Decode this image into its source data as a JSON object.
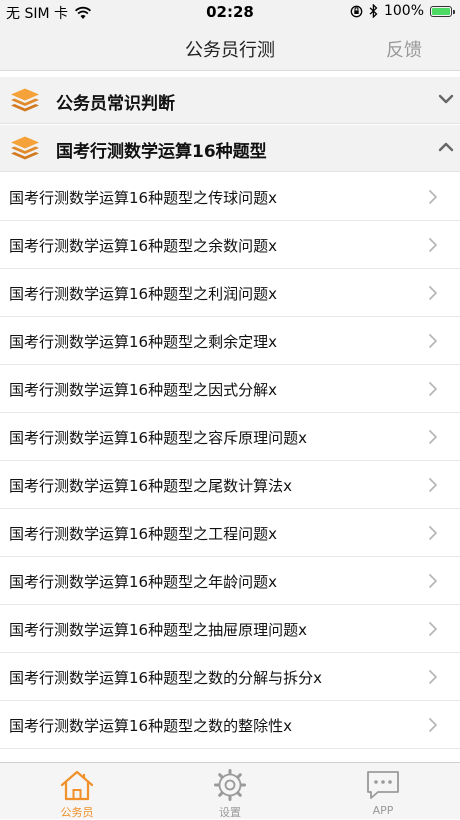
{
  "status_bar": {
    "carrier": "无 SIM 卡",
    "time": "02:28",
    "battery": "100%",
    "battery_level": 1.0
  },
  "header": {
    "title": "公务员行测",
    "feedback_label": "反馈"
  },
  "sections": [
    {
      "label": "公务员常识判断",
      "expanded": false
    },
    {
      "label": "国考行测数学运算16种题型",
      "expanded": true
    }
  ],
  "items": [
    {
      "label": "国考行测数学运算16种题型之传球问题x"
    },
    {
      "label": "国考行测数学运算16种题型之余数问题x"
    },
    {
      "label": "国考行测数学运算16种题型之利润问题x"
    },
    {
      "label": "国考行测数学运算16种题型之剩余定理x"
    },
    {
      "label": "国考行测数学运算16种题型之因式分解x"
    },
    {
      "label": "国考行测数学运算16种题型之容斥原理问题x"
    },
    {
      "label": "国考行测数学运算16种题型之尾数计算法x"
    },
    {
      "label": "国考行测数学运算16种题型之工程问题x"
    },
    {
      "label": "国考行测数学运算16种题型之年龄问题x"
    },
    {
      "label": "国考行测数学运算16种题型之抽屉原理问题x"
    },
    {
      "label": "国考行测数学运算16种题型之数的分解与拆分x"
    },
    {
      "label": "国考行测数学运算16种题型之数的整除性x"
    }
  ],
  "tabs": [
    {
      "label": "公务员",
      "icon": "home-icon",
      "active": true
    },
    {
      "label": "设置",
      "icon": "gear-icon",
      "active": false
    },
    {
      "label": "APP",
      "icon": "chat-bubble-icon",
      "active": false
    }
  ],
  "colors": {
    "accent": "#f0912c",
    "header_bg": "#f2f2f2",
    "inactive_tab": "#9a9a9a"
  }
}
